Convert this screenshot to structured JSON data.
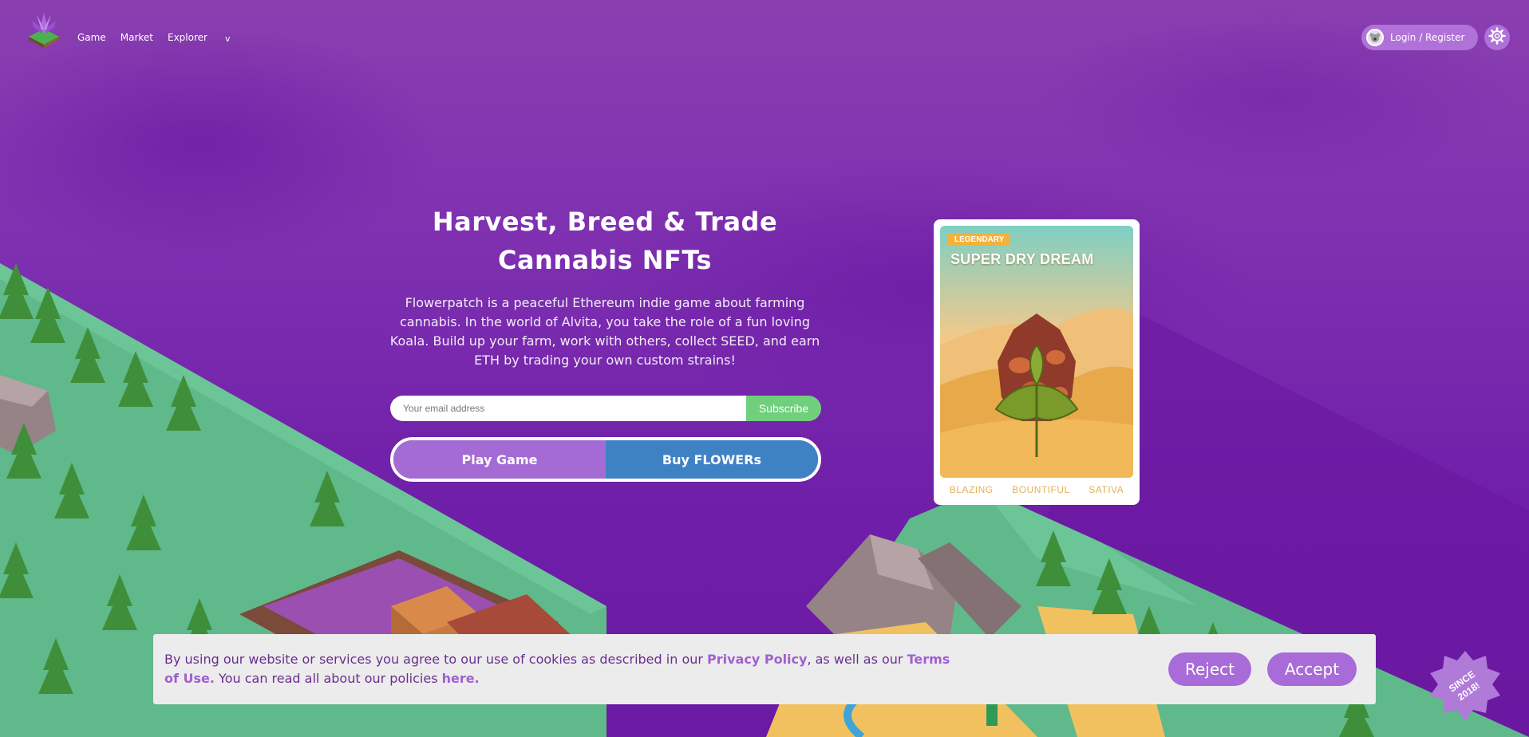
{
  "nav": {
    "links": [
      "Game",
      "Market",
      "Explorer"
    ],
    "caret": "v",
    "login_label": "Login / Register"
  },
  "hero": {
    "title_line1": "Harvest, Breed & Trade",
    "title_line2": "Cannabis NFTs",
    "description": "Flowerpatch is a peaceful Ethereum indie game about farming cannabis. In the world of Alvita, you take the role of a fun loving Koala. Build up your farm, work with others, collect SEED, and earn ETH by trading your own custom strains!",
    "email_placeholder": "Your email address",
    "subscribe_label": "Subscribe",
    "play_label": "Play Game",
    "buy_label": "Buy FLOWERs"
  },
  "card": {
    "rarity": "LEGENDARY",
    "name": "SUPER DRY DREAM",
    "traits": [
      "BLAZING",
      "BOUNTIFUL",
      "SATIVA"
    ]
  },
  "cookie": {
    "text_before": "By using our website or services you agree to our use of cookies as described in our ",
    "privacy_link": "Privacy Policy",
    "text_middle": ", as well as our ",
    "terms_link": "Terms of Use.",
    "text_after": " You can read all about our policies ",
    "here_link": "here.",
    "reject_label": "Reject",
    "accept_label": "Accept"
  },
  "badge": {
    "line1": "SINCE",
    "line2": "2018!"
  },
  "colors": {
    "background": "#7d2fb0",
    "accent": "#a86bd8",
    "subscribe": "#6fcf7c",
    "buy": "#3f82c4",
    "legendary": "#f3b23a"
  }
}
